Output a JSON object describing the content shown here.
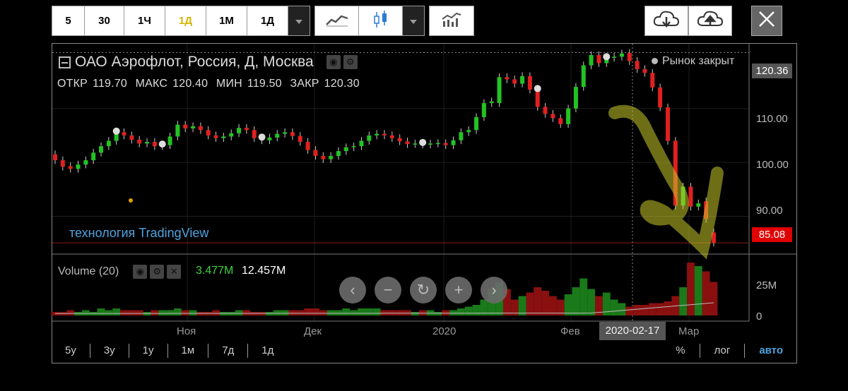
{
  "toolbar": {
    "intervals": [
      "5",
      "30",
      "1Ч",
      "1Д",
      "1М",
      "1Д"
    ],
    "active_interval": "1Д"
  },
  "header": {
    "title": "ОАО Аэрофлот, Россия, Д, Москва",
    "market_status": "Рынок закрыт",
    "ohlc": {
      "open_label": "ОТКР",
      "open": "119.70",
      "high_label": "МАКС",
      "high": "120.40",
      "low_label": "МИН",
      "low": "119.50",
      "close_label": "ЗАКР",
      "close": "120.30"
    }
  },
  "price_axis": {
    "ticks": [
      "110.00",
      "100.00",
      "90.00"
    ],
    "crosshair_value": "120.36",
    "last_value": "85.08"
  },
  "watermark": "технология TradingView",
  "volume": {
    "label": "Volume (20)",
    "value": "3.477M",
    "ma_value": "12.457M",
    "ticks": [
      "25M",
      "0"
    ]
  },
  "time_axis": {
    "labels": [
      "Ноя",
      "Дек",
      "2020",
      "Фев",
      "Мар"
    ],
    "crosshair_date": "2020-02-17"
  },
  "ranges": [
    "5у",
    "3у",
    "1у",
    "1м",
    "7д",
    "1д"
  ],
  "scale_options": {
    "percent": "%",
    "log": "лог",
    "auto": "авто"
  },
  "colors": {
    "up": "#22c322",
    "down": "#e02020",
    "accent": "#4fa3e0",
    "active": "#d6b400"
  },
  "chart_data": {
    "type": "candlestick",
    "y_range": [
      83,
      122
    ],
    "candles": [
      [
        101.5,
        100.4
      ],
      [
        100.4,
        99.2
      ],
      [
        99.3,
        98.8
      ],
      [
        98.8,
        99.6
      ],
      [
        99.6,
        100.4
      ],
      [
        100.4,
        101.8
      ],
      [
        101.8,
        103
      ],
      [
        103,
        104
      ],
      [
        104,
        105.6
      ],
      [
        105.6,
        105
      ],
      [
        105,
        104.2
      ],
      [
        104.2,
        103.5
      ],
      [
        103.5,
        103.8
      ],
      [
        103.8,
        103
      ],
      [
        103,
        103.2
      ],
      [
        103.2,
        104.8
      ],
      [
        104.8,
        107
      ],
      [
        107,
        106.3
      ],
      [
        106.3,
        106.7
      ],
      [
        106.7,
        106
      ],
      [
        106,
        105
      ],
      [
        105,
        104.5
      ],
      [
        104.5,
        104.8
      ],
      [
        104.8,
        105.4
      ],
      [
        105.4,
        106.4
      ],
      [
        106.4,
        106
      ],
      [
        106,
        104.5
      ],
      [
        104.5,
        104.1
      ],
      [
        104.1,
        104.6
      ],
      [
        104.6,
        105.3
      ],
      [
        105.3,
        105.6
      ],
      [
        105.6,
        104.9
      ],
      [
        104.9,
        103.8
      ],
      [
        103.8,
        102.3
      ],
      [
        102.3,
        101.2
      ],
      [
        101.2,
        100.6
      ],
      [
        100.6,
        101.2
      ],
      [
        101.2,
        102.1
      ],
      [
        102.1,
        102.8
      ],
      [
        102.8,
        103
      ],
      [
        103,
        104
      ],
      [
        104,
        105
      ],
      [
        105,
        105.3
      ],
      [
        105.3,
        105
      ],
      [
        105,
        104.5
      ],
      [
        104.5,
        103.9
      ],
      [
        103.9,
        103.4
      ],
      [
        103.4,
        103.5
      ],
      [
        103.5,
        103.3
      ],
      [
        103.3,
        103.5
      ],
      [
        103.5,
        103.6
      ],
      [
        103.6,
        103.2
      ],
      [
        103.2,
        104.1
      ],
      [
        104.1,
        105.6
      ],
      [
        105.6,
        106
      ],
      [
        106,
        108.4
      ],
      [
        108.4,
        111
      ],
      [
        111,
        111.3
      ],
      [
        111,
        115.8
      ],
      [
        115.8,
        115.4
      ],
      [
        115.4,
        114.6
      ],
      [
        114.6,
        116
      ],
      [
        116,
        113.5
      ],
      [
        113.5,
        110.3
      ],
      [
        110.3,
        109
      ],
      [
        109,
        108.2
      ],
      [
        108.2,
        107.1
      ],
      [
        107.1,
        110
      ],
      [
        110,
        114
      ],
      [
        114,
        118
      ],
      [
        118,
        119.9
      ],
      [
        119.9,
        118.4
      ],
      [
        118.4,
        119.4
      ],
      [
        119.4,
        119.6
      ],
      [
        119.6,
        120.2
      ],
      [
        120.3,
        118.8
      ],
      [
        118.8,
        117.3
      ],
      [
        117.3,
        116.6
      ],
      [
        116.6,
        113.9
      ],
      [
        113.9,
        110.2
      ],
      [
        110.2,
        104
      ],
      [
        104,
        92
      ],
      [
        92,
        95.5
      ],
      [
        95.5,
        91.8
      ],
      [
        91.8,
        92.4
      ],
      [
        92.8,
        89.5
      ],
      [
        87,
        85.1
      ]
    ],
    "volume": [
      2,
      2,
      3,
      2,
      3,
      2,
      4,
      3,
      4,
      3,
      3,
      3,
      2,
      3,
      3,
      3,
      4,
      3,
      3,
      2,
      2,
      3,
      2,
      2,
      3,
      3,
      2,
      2,
      2,
      3,
      3,
      3,
      3,
      4,
      4,
      3,
      3,
      3,
      4,
      3,
      4,
      4,
      4,
      3,
      3,
      3,
      3,
      2,
      3,
      3,
      2,
      3,
      3,
      4,
      5,
      6,
      9,
      15,
      19,
      15,
      9,
      11,
      13,
      16,
      14,
      11,
      9,
      12,
      16,
      21,
      15,
      11,
      13,
      9,
      7,
      5,
      6,
      6,
      7,
      7,
      8,
      11,
      16,
      30,
      28,
      25,
      19
    ]
  }
}
